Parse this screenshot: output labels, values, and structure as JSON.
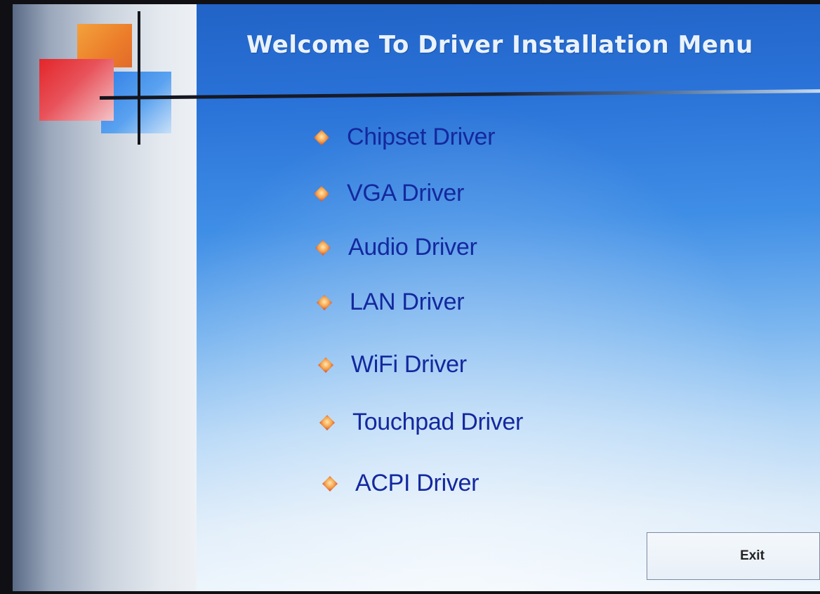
{
  "window": {
    "title": "Welcome To Driver Installation Menu"
  },
  "menu": {
    "bullet_icon": "diamond-bullet-icon",
    "items": [
      {
        "label": "Chipset Driver"
      },
      {
        "label": "VGA Driver"
      },
      {
        "label": "Audio Driver"
      },
      {
        "label": "LAN Driver"
      },
      {
        "label": "WiFi Driver"
      },
      {
        "label": "Touchpad Driver"
      },
      {
        "label": "ACPI Driver"
      }
    ]
  },
  "footer": {
    "exit_label": "Exit"
  },
  "colors": {
    "background_top": "#2162c6",
    "background_bottom": "#eef6fd",
    "menu_text": "#14289e",
    "title_text": "#e9f2fb",
    "bullet_accent": "#f0913a"
  }
}
